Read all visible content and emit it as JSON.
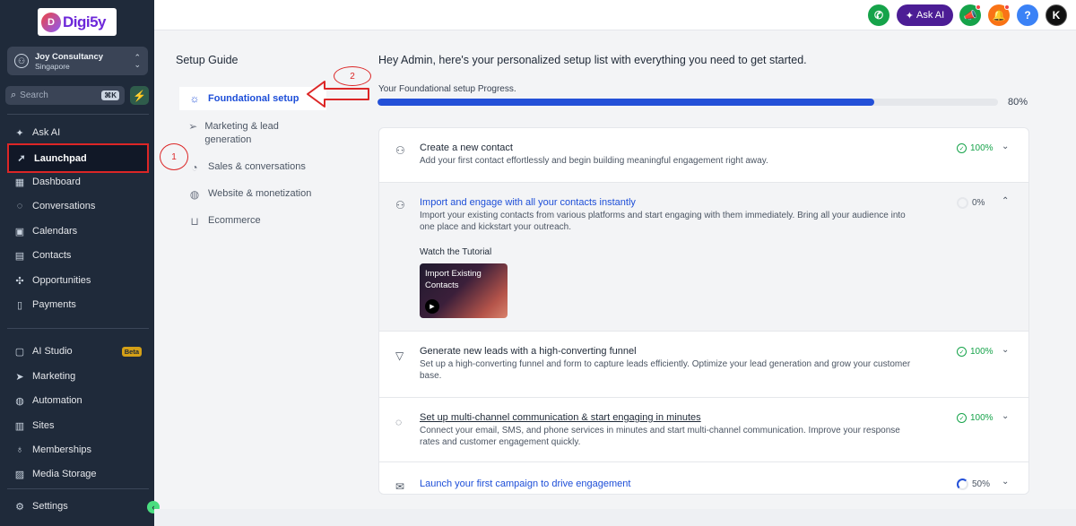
{
  "brand": {
    "logo_text": "Digi5y",
    "logo_mark": "D"
  },
  "account": {
    "name": "Joy Consultancy",
    "location": "Singapore"
  },
  "search": {
    "placeholder": "Search",
    "shortcut": "⌘K"
  },
  "sidebar": {
    "items": [
      {
        "id": "ask-ai",
        "label": "Ask AI",
        "icon": "sparkle-icon",
        "glyph": "✦"
      },
      {
        "id": "launchpad",
        "label": "Launchpad",
        "icon": "rocket-icon",
        "glyph": "➚",
        "active": true
      },
      {
        "id": "dashboard",
        "label": "Dashboard",
        "icon": "grid-icon",
        "glyph": "▦"
      },
      {
        "id": "conversations",
        "label": "Conversations",
        "icon": "chat-icon",
        "glyph": "◌"
      },
      {
        "id": "calendars",
        "label": "Calendars",
        "icon": "calendar-icon",
        "glyph": "▣"
      },
      {
        "id": "contacts",
        "label": "Contacts",
        "icon": "contact-card-icon",
        "glyph": "▤"
      },
      {
        "id": "opportunities",
        "label": "Opportunities",
        "icon": "network-icon",
        "glyph": "✣"
      },
      {
        "id": "payments",
        "label": "Payments",
        "icon": "receipt-icon",
        "glyph": "▯"
      },
      {
        "id": "ai-studio",
        "label": "AI Studio",
        "icon": "ai-studio-icon",
        "glyph": "▢",
        "badge": "Beta"
      },
      {
        "id": "marketing",
        "label": "Marketing",
        "icon": "send-icon",
        "glyph": "➤"
      },
      {
        "id": "automation",
        "label": "Automation",
        "icon": "automation-icon",
        "glyph": "◍"
      },
      {
        "id": "sites",
        "label": "Sites",
        "icon": "globe-icon",
        "glyph": "▥"
      },
      {
        "id": "memberships",
        "label": "Memberships",
        "icon": "badge-icon",
        "glyph": "♁"
      },
      {
        "id": "media-storage",
        "label": "Media Storage",
        "icon": "image-icon",
        "glyph": "▨"
      },
      {
        "id": "settings",
        "label": "Settings",
        "icon": "gear-icon",
        "glyph": "⚙"
      }
    ]
  },
  "topbar": {
    "ask_ai_label": "Ask AI",
    "help_glyph": "?",
    "avatar_letter": "K"
  },
  "setup_guide": {
    "title": "Setup Guide",
    "items": [
      {
        "label": "Foundational setup",
        "icon": "sun-icon",
        "glyph": "☼",
        "active": true
      },
      {
        "label": "Marketing & lead generation",
        "icon": "send-icon",
        "glyph": "➢"
      },
      {
        "label": "Sales & conversations",
        "icon": "gauge-icon",
        "glyph": "◔"
      },
      {
        "label": "Website & monetization",
        "icon": "globe-icon",
        "glyph": "◍"
      },
      {
        "label": "Ecommerce",
        "icon": "cart-icon",
        "glyph": "⊔"
      }
    ]
  },
  "annotations": {
    "step1": "1",
    "step2": "2"
  },
  "main": {
    "greeting": "Hey Admin, here's your personalized setup list with everything you need to get started.",
    "progress_label": "Your Foundational setup Progress.",
    "progress_value": 80,
    "progress_text": "80%",
    "tasks": [
      {
        "title": "Create a new contact",
        "desc": "Add your first contact effortlessly and begin building meaningful engagement right away.",
        "status": "100%",
        "icon": "add-user-icon",
        "glyph": "⚇"
      },
      {
        "title": "Import and engage with all your contacts instantly",
        "desc": "Import your existing contacts from various platforms and start engaging with them immediately. Bring all your audience into one place and kickstart your outreach.",
        "status": "0%",
        "icon": "add-user-icon",
        "glyph": "⚇",
        "expanded": true,
        "watch_label": "Watch the Tutorial",
        "video_title": "Import Existing Contacts"
      },
      {
        "title": "Generate new leads with a high-converting funnel",
        "desc": "Set up a high-converting funnel and form to capture leads efficiently. Optimize your lead generation and grow your customer base.",
        "status": "100%",
        "icon": "funnel-icon",
        "glyph": "▽"
      },
      {
        "title": "Set up multi-channel communication & start engaging in minutes",
        "desc": "Connect your email, SMS, and phone services in minutes and start multi-channel communication. Improve your response rates and customer engagement quickly.",
        "status": "100%",
        "icon": "message-icon",
        "glyph": "◌"
      },
      {
        "title": "Launch your first campaign to drive engagement",
        "desc": "",
        "status": "50%",
        "icon": "mail-icon",
        "glyph": "✉"
      }
    ]
  }
}
